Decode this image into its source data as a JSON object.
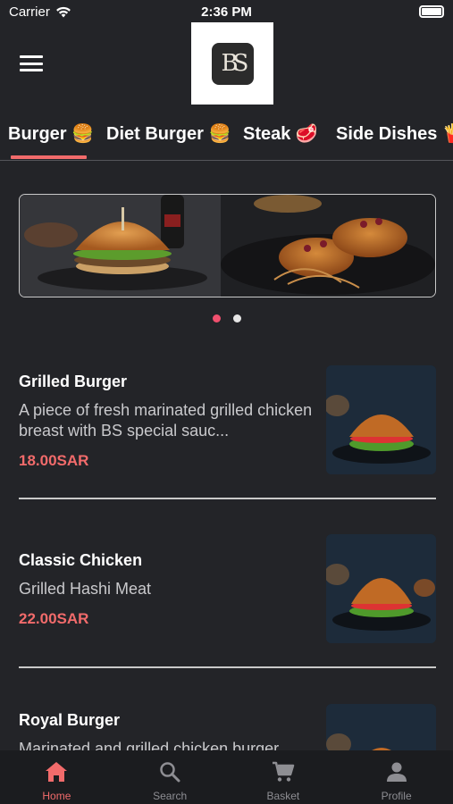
{
  "status_bar": {
    "carrier": "Carrier",
    "time": "2:36 PM"
  },
  "header": {
    "logo_text": "BS"
  },
  "tabs": [
    {
      "label": "Burger 🍔",
      "active": true
    },
    {
      "label": "Diet Burger 🍔",
      "active": false
    },
    {
      "label": "Steak 🥩",
      "active": false
    },
    {
      "label": "Side Dishes 🍟",
      "active": false
    }
  ],
  "carousel": {
    "total": 2,
    "active_index": 0
  },
  "items": [
    {
      "title": "Grilled Burger",
      "description": "A piece of fresh marinated grilled chicken breast with BS special sauc...",
      "price": "18.00SAR"
    },
    {
      "title": "Classic Chicken",
      "description": "Grilled Hashi Meat",
      "price": "22.00SAR"
    },
    {
      "title": "Royal Burger",
      "description": "Marinated and grilled chicken burger",
      "price": ""
    }
  ],
  "bottom_nav": [
    {
      "label": "Home",
      "icon": "home-icon",
      "active": true
    },
    {
      "label": "Search",
      "icon": "search-icon",
      "active": false
    },
    {
      "label": "Basket",
      "icon": "cart-icon",
      "active": false
    },
    {
      "label": "Profile",
      "icon": "person-icon",
      "active": false
    }
  ],
  "colors": {
    "accent": "#f26b6b",
    "background": "#232428",
    "nav_background": "#1b1c1f",
    "inactive": "#8e8e93"
  }
}
